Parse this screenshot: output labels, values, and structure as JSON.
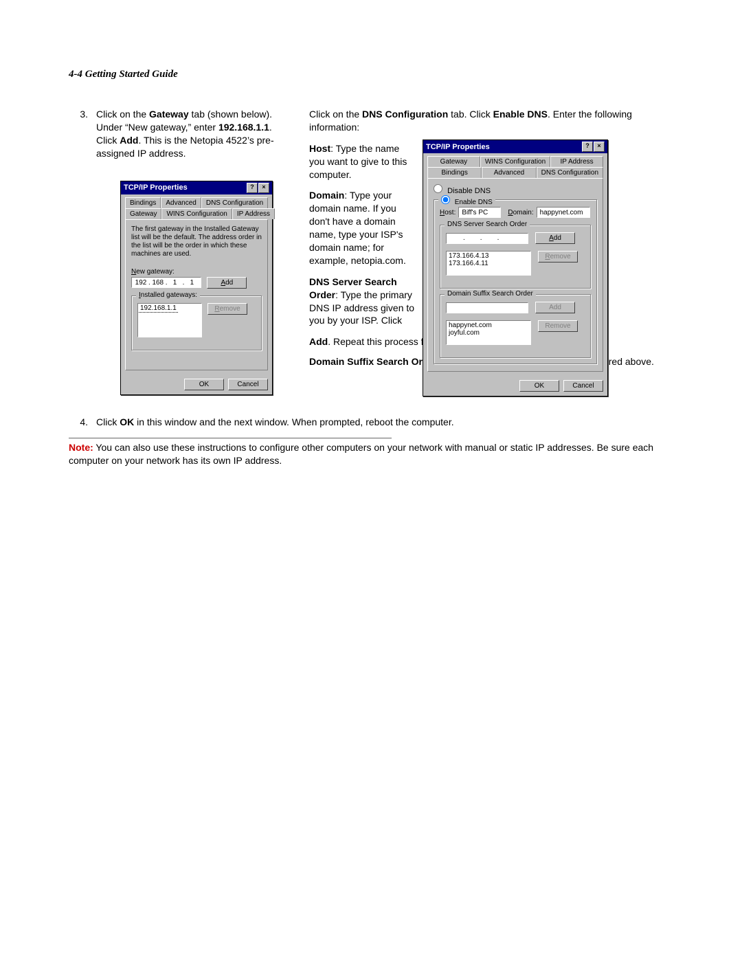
{
  "header": "4-4  Getting Started Guide",
  "step3": {
    "num": "3.",
    "text_a": "Click on the ",
    "gateway_bold": "Gateway",
    "text_b": " tab (shown below). Under “New gateway,” enter ",
    "ip_bold": "192.168.1.1",
    "text_c": ". Click ",
    "add_bold": "Add",
    "text_d": ". This is the Netopia 4522’s pre-assigned IP address."
  },
  "right_intro": {
    "a": "Click on the ",
    "dns_bold": "DNS Configuration",
    "b": " tab. Click ",
    "enable_bold": "Enable DNS",
    "c": ". Enter the following information:"
  },
  "host_para": {
    "label": "Host",
    "text": ": Type the name you want to give to this computer."
  },
  "domain_para": {
    "label": "Domain",
    "text": ": Type your domain name. If you don't have a domain name, type your ISP's domain name; for example, netopia.com."
  },
  "dnssearch_para": {
    "label": "DNS Server Search Order",
    "text": ": Type the primary DNS IP address given to you by your ISP. Click "
  },
  "dnssearch_tail": {
    "add_bold": "Add",
    "rest": ". Repeat this process for the secondary DNS."
  },
  "suffix_para": {
    "label": "Domain Suffix Search Order",
    "text": ": Enter the same domain name you entered above."
  },
  "step4": {
    "num": "4.",
    "a": "Click ",
    "ok_bold": "OK",
    "b": " in this window and the next window. When prompted, reboot the computer."
  },
  "note": {
    "label": "Note:",
    "text": "  You can also use these instructions to configure other computers on your network with manual or static IP addresses. Be sure each computer on your network has its own IP address."
  },
  "dlg_left": {
    "title": "TCP/IP Properties",
    "tabs_top": [
      "Bindings",
      "Advanced",
      "DNS Configuration"
    ],
    "tabs_bottom": [
      "Gateway",
      "WINS Configuration",
      "IP Address"
    ],
    "help": "The first gateway in the Installed Gateway list will be the default. The address order in the list will be the order in which these machines are used.",
    "new_gateway_label": "New gateway:",
    "ip_segments": [
      "192",
      "168",
      "1",
      "1"
    ],
    "add_btn": "Add",
    "installed_label": "Installed gateways:",
    "installed_item": "192.168.1.1",
    "remove_btn": "Remove",
    "ok": "OK",
    "cancel": "Cancel"
  },
  "dlg_right": {
    "title": "TCP/IP Properties",
    "tabs_top": [
      "Gateway",
      "WINS Configuration",
      "IP Address"
    ],
    "tabs_bottom": [
      "Bindings",
      "Advanced",
      "DNS Configuration"
    ],
    "disable": "Disable DNS",
    "enable": "Enable DNS",
    "host_label": "Host:",
    "host_val": "Biff's PC",
    "domain_label": "Domain:",
    "domain_val": "happynet.com",
    "dns_order_label": "DNS Server Search Order",
    "add_btn": "Add",
    "remove_btn": "Remove",
    "dns_items": [
      "173.166.4.13",
      "173.166.4.11"
    ],
    "suffix_label": "Domain Suffix Search Order",
    "suffix_add": "Add",
    "suffix_remove": "Remove",
    "suffix_items": [
      "happynet.com",
      "joyful.com"
    ],
    "ok": "OK",
    "cancel": "Cancel"
  }
}
